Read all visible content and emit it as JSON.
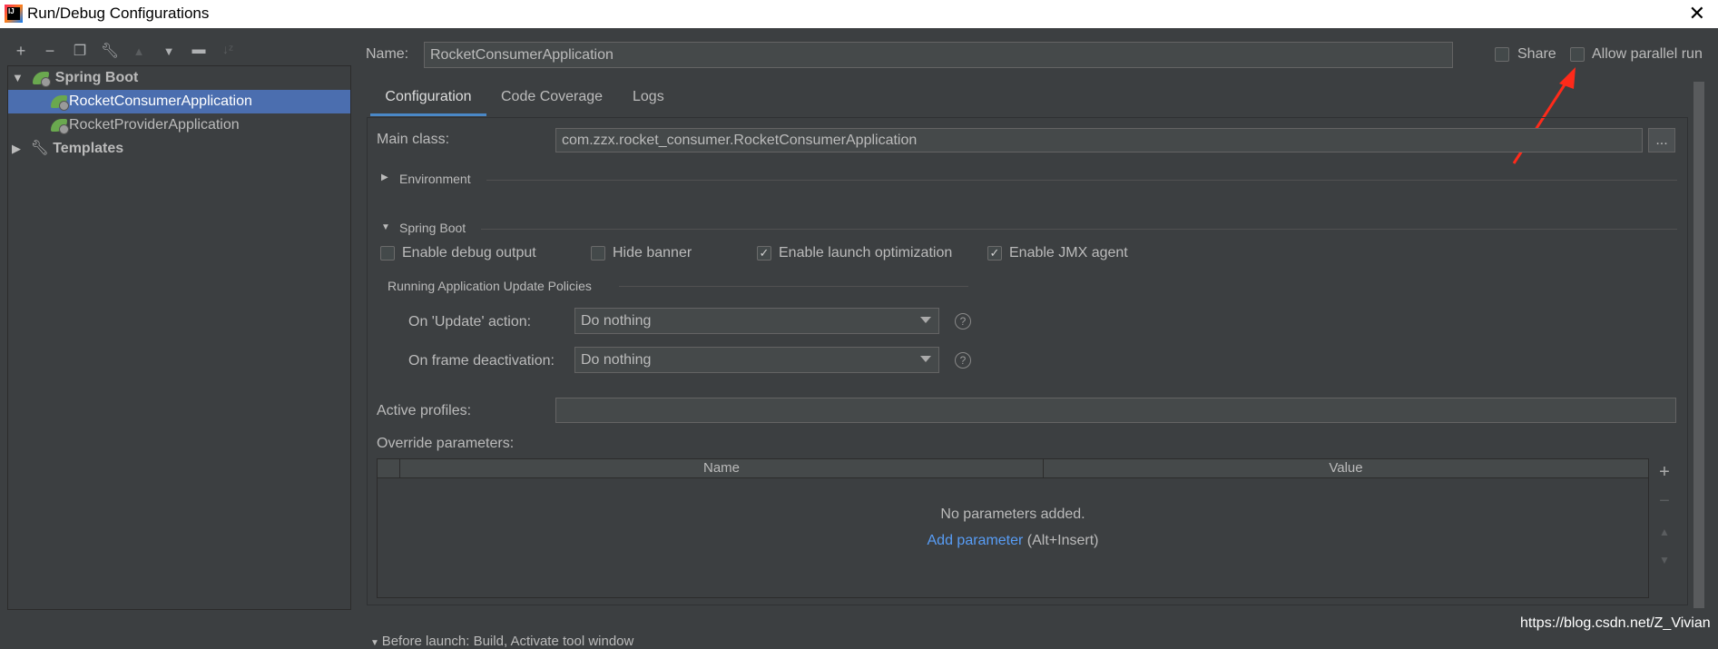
{
  "window": {
    "title": "Run/Debug Configurations",
    "close": "✕",
    "app_icon": "IJ"
  },
  "toolbar": {
    "icons": [
      "plus-icon",
      "minus-icon",
      "copy-icon",
      "wrench-icon",
      "arrow-up-icon",
      "arrow-down-icon",
      "new-folder-icon",
      "sort-alpha-icon"
    ]
  },
  "tree": {
    "group": "Spring Boot",
    "items": [
      {
        "label": "RocketConsumerApplication",
        "selected": true
      },
      {
        "label": "RocketProviderApplication",
        "selected": false
      }
    ],
    "templates": "Templates"
  },
  "header": {
    "name_label": "Name:",
    "name_value": "RocketConsumerApplication",
    "share_label": "Share",
    "share_checked": false,
    "parallel_label": "Allow parallel run",
    "parallel_checked": false
  },
  "tabs": [
    {
      "label": "Configuration",
      "active": true
    },
    {
      "label": "Code Coverage"
    },
    {
      "label": "Logs"
    }
  ],
  "config": {
    "main_class_label": "Main class:",
    "main_class_value": "com.zzx.rocket_consumer.RocketConsumerApplication",
    "browse_label": "...",
    "environment_label": "Environment",
    "spring_boot_label": "Spring Boot",
    "checkboxes": [
      {
        "label": "Enable debug output",
        "checked": false
      },
      {
        "label": "Hide banner",
        "checked": false
      },
      {
        "label": "Enable launch optimization",
        "checked": true
      },
      {
        "label": "Enable JMX agent",
        "checked": true
      }
    ],
    "policies_label": "Running Application Update Policies",
    "update_action_label": "On 'Update' action:",
    "update_action_value": "Do nothing",
    "frame_deactivation_label": "On frame deactivation:",
    "frame_deactivation_value": "Do nothing",
    "help": "?",
    "active_profiles_label": "Active profiles:",
    "active_profiles_value": "",
    "override_label": "Override parameters:",
    "table": {
      "columns": [
        "Name",
        "Value"
      ],
      "empty_text": "No parameters added.",
      "add_link": "Add parameter",
      "add_hint": "(Alt+Insert)"
    },
    "side_buttons": [
      "+",
      "−",
      "▲",
      "▼"
    ],
    "before_launch": "Before launch: Build, Activate tool window"
  },
  "watermark": "https://blog.csdn.net/Z_Vivian",
  "colors": {
    "background": "#3c3f41",
    "selection": "#4b6eaf",
    "accent": "#4a88c7",
    "link": "#589df6",
    "arrow": "#ff2a1a"
  }
}
